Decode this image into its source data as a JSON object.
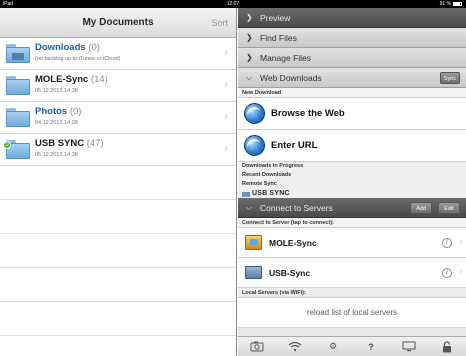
{
  "status_bar": {
    "device": "iPad",
    "time": "12:07",
    "battery": "91 %"
  },
  "left": {
    "title": "My Documents",
    "sort_label": "Sort",
    "items": [
      {
        "name": "Downloads",
        "count": "(0)",
        "meta": "(no backing up to iTunes or iCloud)",
        "highlight": true
      },
      {
        "name": "MOLE-Sync",
        "count": "(14)",
        "meta": "05.12.2013 14:36"
      },
      {
        "name": "Photos",
        "count": "(0)",
        "meta": "04.12.2013 14:08"
      },
      {
        "name": "USB SYNC",
        "count": "(47)",
        "meta": "05.12.2013 14:36"
      }
    ]
  },
  "right": {
    "preview": "Preview",
    "find_files": "Find Files",
    "manage_files": "Manage Files",
    "web_downloads": "Web Downloads",
    "sync_btn": "Sync",
    "new_download": "New Download",
    "browse_web": "Browse the Web",
    "enter_url": "Enter URL",
    "downloads_in_progress": "Downloads in Progress",
    "recent_downloads": "Recent Downloads",
    "remote_sync": "Remote Sync",
    "usb_sync_partial": "USB SYNC",
    "connect_servers": "Connect to Servers",
    "add_btn": "Add",
    "edit_btn": "Edit",
    "connect_label": "Connect to Server (tap to connect):",
    "servers": [
      {
        "name": "MOLE-Sync"
      },
      {
        "name": "USB-Sync"
      }
    ],
    "local_servers": "Local Servers (via WiFi):",
    "reload": "reload list of local servers"
  },
  "toolbar": {
    "icons": [
      "camera-icon",
      "wifi-icon",
      "gear-icon",
      "help-icon",
      "monitor-icon",
      "lock-icon"
    ]
  }
}
